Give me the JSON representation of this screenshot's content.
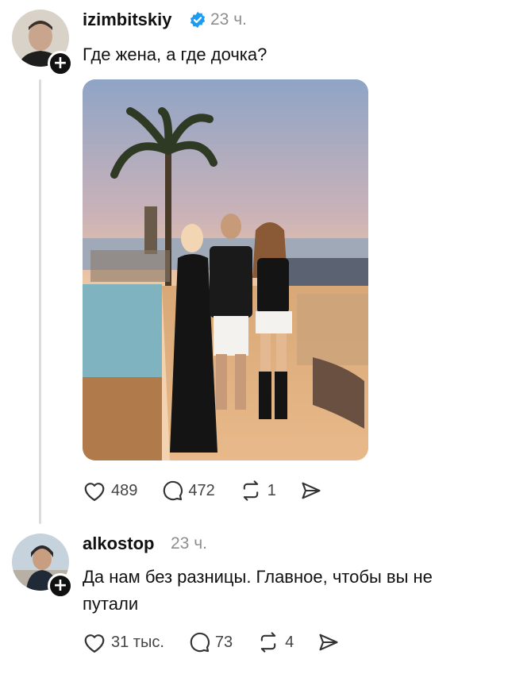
{
  "post": {
    "username": "izimbitskiy",
    "verified": true,
    "time": "23 ч.",
    "text": "Где жена, а где дочка?",
    "likes": "489",
    "comments": "472",
    "reposts": "1"
  },
  "reply": {
    "username": "alkostop",
    "time": "23 ч.",
    "text_line1": "Да нам без разницы. Главное, чтобы вы не",
    "text_line2": "путали",
    "likes": "31 тыс.",
    "comments": "73",
    "reposts": "4"
  },
  "icons": {
    "like": "heart-icon",
    "comment": "comment-bubble-icon",
    "repost": "repost-icon",
    "share": "send-icon",
    "verified": "verified-badge-icon",
    "follow": "plus-icon"
  },
  "colors": {
    "verified_blue": "#1d9bf0",
    "muted_text": "#8e8e8e",
    "text": "#111111"
  }
}
